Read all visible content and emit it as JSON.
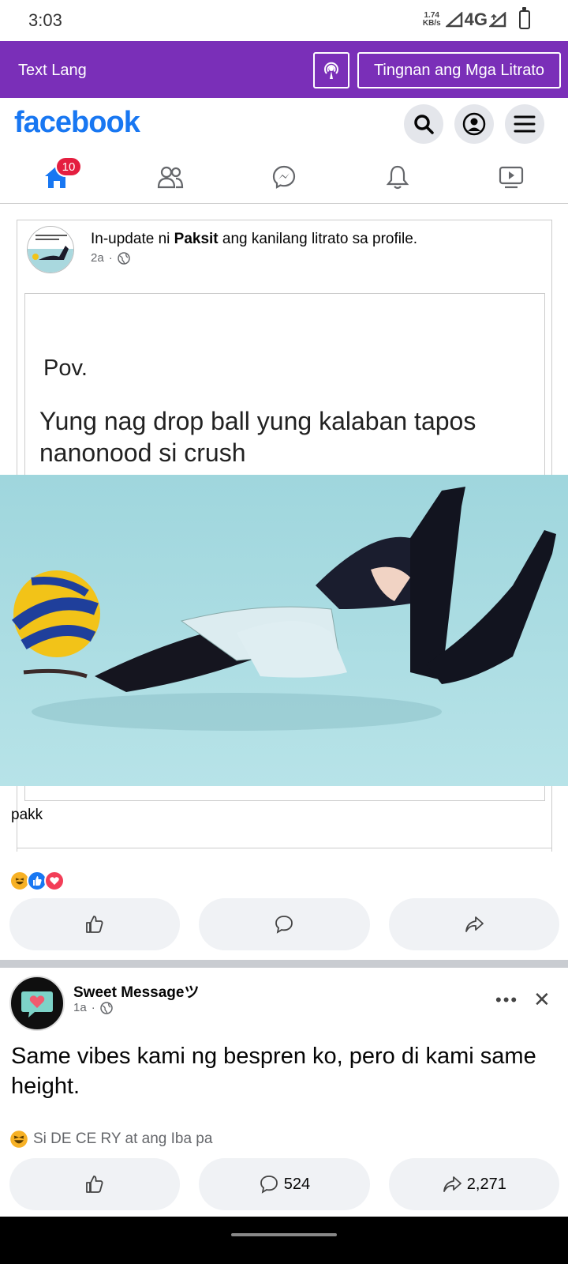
{
  "status_bar": {
    "time": "3:03",
    "speed_value": "1.74",
    "speed_unit": "KB/s",
    "network": "4G"
  },
  "banner": {
    "text_mode": "Text Lang",
    "view_photos": "Tingnan ang Mga Litrato"
  },
  "header": {
    "logo": "facebook",
    "icons": [
      "search-icon",
      "profile-icon",
      "menu-icon"
    ],
    "brand_color": "#1877f2"
  },
  "nav": {
    "tabs": [
      "home",
      "friends",
      "messenger",
      "notifications",
      "watch"
    ],
    "home_badge": "10",
    "active_color": "#1877f2"
  },
  "post1": {
    "action_prefix": "In-update ni ",
    "author": "Paksit",
    "action_suffix": " ang kanilang litrato sa profile.",
    "time": "2a",
    "meme_pov": "Pov.",
    "meme_caption": "Yung nag drop ball yung kalaban tapos nanonood si crush",
    "caption": "pakk",
    "reactions": [
      "haha",
      "like",
      "love"
    ]
  },
  "post2": {
    "author": "Sweet Messageツ",
    "time": "1a",
    "text": "Same vibes kami ng bespren ko, pero di kami same height.",
    "reaction_summary": "Si DE CE RY at ang Iba pa",
    "comments": "524",
    "shares": "2,271"
  }
}
